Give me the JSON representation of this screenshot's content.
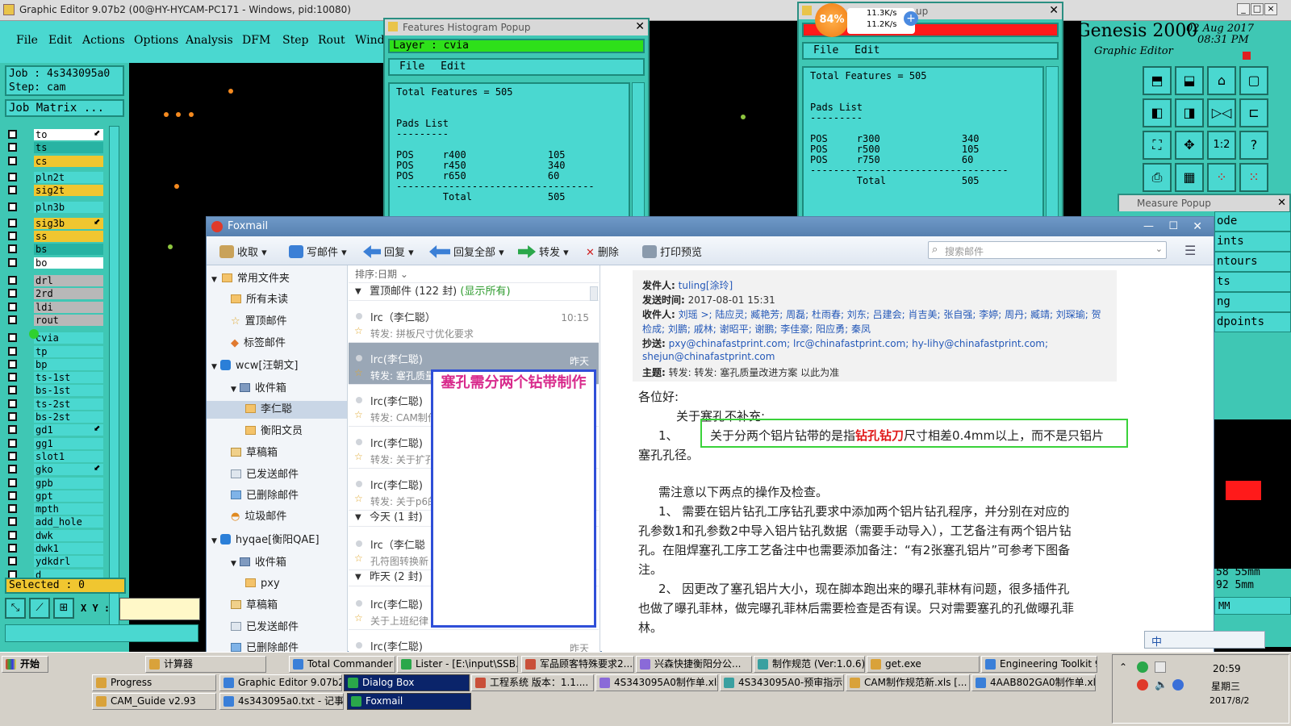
{
  "genesis": {
    "title": "Graphic Editor 9.07b2 (00@HY-HYCAM-PC171 - Windows, pid:10080)",
    "menu": [
      "File",
      "Edit",
      "Actions",
      "Options",
      "Analysis",
      "DFM",
      "Step",
      "Rout",
      "Window"
    ],
    "job": "Job : 4s343095a0",
    "step": "Step: cam",
    "job_matrix": "Job Matrix ...",
    "layers": [
      {
        "name": "to",
        "color": "white",
        "flag": "⬋"
      },
      {
        "name": "ts",
        "color": "teal",
        "flag": ""
      },
      {
        "name": "cs",
        "color": "yellow",
        "flag": ""
      },
      {
        "name": "pln2t",
        "color": "cyan",
        "flag": ""
      },
      {
        "name": "sig2t",
        "color": "yellow",
        "flag": ""
      },
      {
        "name": "pln3b",
        "color": "cyan",
        "flag": ""
      },
      {
        "name": "sig3b",
        "color": "yellow",
        "flag": "⬋"
      },
      {
        "name": "ss",
        "color": "yellow",
        "flag": ""
      },
      {
        "name": "bs",
        "color": "teal",
        "flag": ""
      },
      {
        "name": "bo",
        "color": "white",
        "flag": ""
      },
      {
        "name": "drl",
        "color": "gray",
        "flag": ""
      },
      {
        "name": "2rd",
        "color": "gray",
        "flag": ""
      },
      {
        "name": "ldi",
        "color": "gray",
        "flag": ""
      },
      {
        "name": "rout",
        "color": "gray",
        "flag": ""
      },
      {
        "name": "cvia",
        "color": "cyan",
        "flag": ""
      },
      {
        "name": "tp",
        "color": "cyan",
        "flag": ""
      },
      {
        "name": "bp",
        "color": "cyan",
        "flag": ""
      },
      {
        "name": "ts-1st",
        "color": "cyan",
        "flag": ""
      },
      {
        "name": "bs-1st",
        "color": "cyan",
        "flag": ""
      },
      {
        "name": "ts-2st",
        "color": "cyan",
        "flag": ""
      },
      {
        "name": "bs-2st",
        "color": "cyan",
        "flag": ""
      },
      {
        "name": "gd1",
        "color": "cyan",
        "flag": "⬋"
      },
      {
        "name": "gg1",
        "color": "cyan",
        "flag": ""
      },
      {
        "name": "slot1",
        "color": "cyan",
        "flag": ""
      },
      {
        "name": "gko",
        "color": "cyan",
        "flag": "⬋"
      },
      {
        "name": "gpb",
        "color": "cyan",
        "flag": ""
      },
      {
        "name": "gpt",
        "color": "cyan",
        "flag": ""
      },
      {
        "name": "mpth",
        "color": "cyan",
        "flag": ""
      },
      {
        "name": "add_hole",
        "color": "cyan",
        "flag": ""
      },
      {
        "name": "dwk",
        "color": "cyan",
        "flag": ""
      },
      {
        "name": "dwk1",
        "color": "cyan",
        "flag": ""
      },
      {
        "name": "ydkdrl",
        "color": "cyan",
        "flag": ""
      },
      {
        "name": "d",
        "color": "cyan",
        "flag": ""
      }
    ],
    "selected": "Selected : 0",
    "xy_label": "X Y :",
    "brand": "Genesis 2000",
    "brand_sub": "Graphic Editor",
    "date": "02 Aug 2017",
    "time": "08:31 PM",
    "right_labels": [
      "ode",
      "ints",
      "ntours",
      "ts",
      "ng",
      "dpoints"
    ],
    "readout1": "58 55mm",
    "readout2": "92 5mm",
    "unit": "MM",
    "net_percent": "84%",
    "net_up": "11.3K/s",
    "net_down": "11.2K/s"
  },
  "hist1": {
    "title": "Features Histogram Popup",
    "layer": "Layer :  cvia",
    "menu": [
      "File",
      "Edit"
    ],
    "body": "Total Features = 505\n\n\nPads List\n---------\n\nPOS     r400              105\nPOS     r450              340\nPOS     r650              60\n----------------------------------\n        Total             505"
  },
  "hist2": {
    "title": "opup",
    "menu": [
      "File",
      "Edit"
    ],
    "body": "Total Features = 505\n\n\nPads List\n---------\n\nPOS     r300              340\nPOS     r500              105\nPOS     r750              60\n----------------------------------\n        Total             505"
  },
  "measure": {
    "title": "Measure Popup"
  },
  "foxmail": {
    "title": "Foxmail",
    "toolbar": [
      "收取",
      "写邮件",
      "回复",
      "回复全部",
      "转发",
      "删除",
      "打印预览"
    ],
    "search_placeholder": "搜索邮件",
    "tree": [
      {
        "label": "常用文件夹",
        "level": 0,
        "kind": "group"
      },
      {
        "label": "所有未读",
        "level": 1,
        "kind": "folder"
      },
      {
        "label": "置顶邮件",
        "level": 1,
        "kind": "star"
      },
      {
        "label": "标签邮件",
        "level": 1,
        "kind": "tag"
      },
      {
        "label": "wcw[汪朝文]",
        "level": 0,
        "kind": "account"
      },
      {
        "label": "收件箱",
        "level": 1,
        "kind": "inbox"
      },
      {
        "label": "李仁聪",
        "level": 2,
        "kind": "folder"
      },
      {
        "label": "衡阳文员",
        "level": 2,
        "kind": "folder"
      },
      {
        "label": "草稿箱",
        "level": 1,
        "kind": "draft"
      },
      {
        "label": "已发送邮件",
        "level": 1,
        "kind": "sent"
      },
      {
        "label": "已删除邮件",
        "level": 1,
        "kind": "trash"
      },
      {
        "label": "垃圾邮件",
        "level": 1,
        "kind": "junk"
      },
      {
        "label": "hyqae[衡阳QAE]",
        "level": 0,
        "kind": "account"
      },
      {
        "label": "收件箱",
        "level": 1,
        "kind": "inbox"
      },
      {
        "label": "pxy",
        "level": 2,
        "kind": "folder"
      },
      {
        "label": "草稿箱",
        "level": 1,
        "kind": "draft"
      },
      {
        "label": "已发送邮件",
        "level": 1,
        "kind": "sent"
      },
      {
        "label": "已删除邮件",
        "level": 1,
        "kind": "trash"
      }
    ],
    "sort_label": "排序:日期",
    "group_pinned": "置顶邮件 (122 封)",
    "show_all": "(显示所有)",
    "group_today": "今天 (1 封)",
    "group_yesterday": "昨天 (2 封)",
    "mails": [
      {
        "from": "lrc（李仁聪）",
        "subject": "转发: 拼板尺寸优化要求",
        "time": "10:15"
      },
      {
        "from": "lrc(李仁聪)",
        "subject": "转发: 塞孔质量改进方案 以此为准",
        "time": "昨天"
      },
      {
        "from": "lrc(李仁聪)",
        "subject": "转发: CAM制作",
        "time": ""
      },
      {
        "from": "lrc(李仁聪)",
        "subject": "转发: 关于扩孔",
        "time": ""
      },
      {
        "from": "lrc(李仁聪)",
        "subject": "转发: 关于p6的",
        "time": ""
      },
      {
        "from": "lrc（李仁聪",
        "subject": "孔符图转换新",
        "time": ""
      },
      {
        "from": "lrc(李仁聪)",
        "subject": "关于上班纪律",
        "time": ""
      },
      {
        "from": "lrc(李仁聪)",
        "subject": "",
        "time": "昨天"
      }
    ],
    "note": "塞孔需分两个钻带制作",
    "header": {
      "from_label": "发件人:",
      "from": "tuling[涂玲]",
      "sent_label": "发送时间:",
      "sent": "2017-08-01 15:31",
      "to_label": "收件人:",
      "to_1": "刘瑶 >; 陆应灵; 臧艳芳; 周磊; 杜雨春; 刘东; 吕建会; 肖吉美; 张自强; 李婷; 周丹; 臧靖; 刘琛瑜; 贺",
      "to_2": "检成; 刘鹏; 戚林; 谢昭平; 谢鹏; 李佳豪; 阳应勇; 秦凤",
      "cc_label": "抄送:",
      "cc_1": "pxy@chinafastprint.com; lrc@chinafastprint.com; hy-lihy@chinafastprint.com;",
      "cc_2": "shejun@chinafastprint.com",
      "subj_label": "主题:",
      "subj": "转发: 转发: 塞孔质量改进方案 以此为准"
    },
    "body": {
      "greeting": "各位好:",
      "l1": "关于塞孔不补充:",
      "l2_num": "1、",
      "l2_a": "关于分两个铝片钻带的是指",
      "l2_b": "钻孔钻刀",
      "l2_c": "尺寸相差0.4mm以上，而不是只铝片",
      "l3": "塞孔孔径。",
      "l4": "需注意以下两点的操作及检查。",
      "l5": "1、       需要在铝片钻孔工序钻孔要求中添加两个铝片钻孔程序，并分别在对应的",
      "l6": "孔参数1和孔参数2中导入铝片钻孔数据（需要手动导入），工艺备注有两个铝片钻",
      "l7": "孔。在阻焊塞孔工序工艺备注中也需要添加备注：“有2张塞孔铝片”可参考下图备",
      "l8": "注。",
      "l9": "2、       因更改了塞孔铝片大小，现在脚本跑出来的曝孔菲林有问题，很多插件孔",
      "l10": "也做了曝孔菲林，做完曝孔菲林后需要检查是否有误。只对需要塞孔的孔做曝孔菲",
      "l11": "林。"
    }
  },
  "taskbar": {
    "start": "开始",
    "row1": [
      "计算器",
      "Total Commander 7.0...",
      "Lister - [E:\\input\\SSB...",
      "军品顾客特殊要求2...",
      "兴森快捷衡阳分公...",
      "制作规范 (Ver:1.0.6)",
      "get.exe",
      "Engineering Toolkit 9...."
    ],
    "row2": [
      "Progress",
      "Graphic Editor 9.07b2 (0...",
      "Dialog Box",
      "工程系统   版本：1.1....",
      "4S343095A0制作单.xls ...",
      "4S343095A0-预审指示...",
      "CAM制作规范新.xls [...",
      "4AAB802GA0制作单.xls..."
    ],
    "row3": [
      "CAM_Guide v2.93",
      "4s343095a0.txt - 记事本",
      "Foxmail"
    ],
    "clock": "20:59",
    "weekday": "星期三",
    "date": "2017/8/2",
    "ime": "中"
  },
  "colors": {
    "genesis_bg": "#3fc7b4",
    "genesis_box": "#4ad8d0",
    "red": "#ff1a1a",
    "accent": "#2f4fd8",
    "note": "#d82a8c"
  }
}
